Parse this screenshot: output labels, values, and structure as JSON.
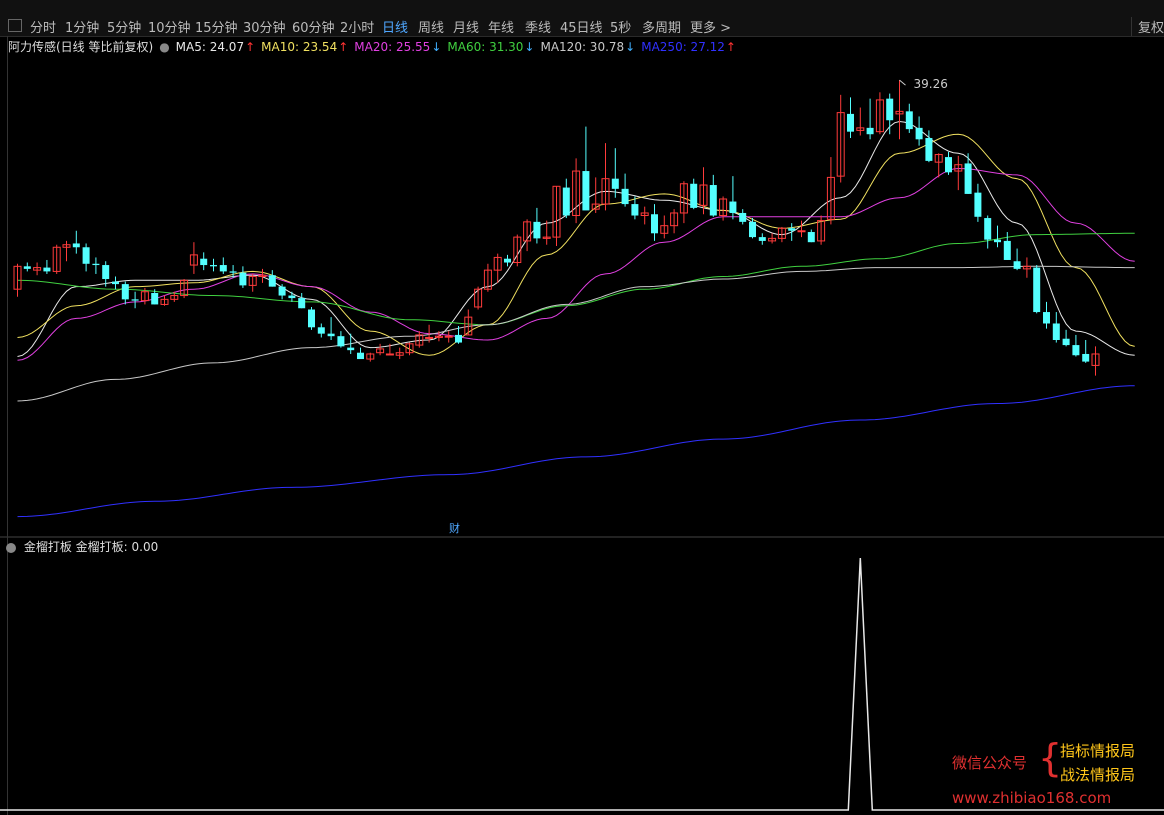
{
  "toolbar": {
    "tabs": [
      "分时",
      "1分钟",
      "5分钟",
      "10分钟",
      "15分钟",
      "30分钟",
      "60分钟",
      "2小时",
      "日线",
      "周线",
      "月线",
      "年线",
      "季线",
      "45日线",
      "5秒",
      "多周期",
      "更多 >"
    ],
    "active": "日线",
    "right_label": "复权"
  },
  "ma_header": {
    "title": "阿力传感(日线 等比前复权)",
    "items": [
      {
        "label": "MA5: 24.07",
        "arrow": "↑",
        "color": "#e8e8e8",
        "arrow_color": "#ff3333"
      },
      {
        "label": "MA10: 23.54",
        "arrow": "↑",
        "color": "#f0e060",
        "arrow_color": "#ff3333"
      },
      {
        "label": "MA20: 25.55",
        "arrow": "↓",
        "color": "#e040e0",
        "arrow_color": "#40b0ff"
      },
      {
        "label": "MA60: 31.30",
        "arrow": "↓",
        "color": "#40d040",
        "arrow_color": "#40b0ff"
      },
      {
        "label": "MA120: 30.78",
        "arrow": "↓",
        "color": "#c8c8c8",
        "arrow_color": "#40b0ff"
      },
      {
        "label": "MA250: 27.12",
        "arrow": "↑",
        "color": "#3030ff",
        "arrow_color": "#ff3333"
      }
    ]
  },
  "main_chart": {
    "peak_label": "39.26",
    "finance_marker": "财"
  },
  "sub_chart": {
    "name": "金榴打板",
    "value_label": "金榴打板: 0.00"
  },
  "watermark": {
    "left": "微信公众号",
    "right1": "指标情报局",
    "right2": "战法情报局",
    "url": "www.zhibiao168.com"
  },
  "chart_data": {
    "type": "candlestick",
    "candles": [
      [
        22.8,
        24.8,
        22.2,
        24.6
      ],
      [
        24.6,
        24.9,
        24.2,
        24.4
      ],
      [
        24.3,
        24.9,
        23.9,
        24.5
      ],
      [
        24.5,
        25.1,
        24.0,
        24.2
      ],
      [
        24.2,
        26.3,
        24.0,
        26.1
      ],
      [
        26.1,
        26.6,
        25.0,
        26.3
      ],
      [
        26.4,
        27.4,
        25.6,
        26.1
      ],
      [
        26.1,
        26.4,
        24.2,
        24.8
      ],
      [
        24.8,
        25.3,
        24.0,
        24.7
      ],
      [
        24.7,
        25.0,
        23.0,
        23.6
      ],
      [
        23.4,
        23.8,
        22.8,
        23.2
      ],
      [
        23.2,
        23.4,
        21.6,
        22.0
      ],
      [
        22.0,
        22.6,
        21.3,
        21.9
      ],
      [
        21.9,
        22.9,
        21.6,
        22.6
      ],
      [
        22.5,
        22.8,
        21.6,
        21.6
      ],
      [
        21.6,
        22.3,
        21.5,
        22.0
      ],
      [
        22.0,
        22.6,
        21.8,
        22.3
      ],
      [
        22.3,
        23.6,
        22.1,
        23.5
      ],
      [
        24.7,
        26.5,
        24.0,
        25.5
      ],
      [
        25.2,
        25.7,
        24.3,
        24.7
      ],
      [
        24.7,
        25.2,
        24.2,
        24.6
      ],
      [
        24.7,
        25.3,
        24.0,
        24.2
      ],
      [
        24.2,
        24.7,
        23.7,
        24.1
      ],
      [
        24.1,
        24.6,
        22.9,
        23.1
      ],
      [
        23.1,
        24.0,
        22.6,
        23.8
      ],
      [
        23.8,
        24.4,
        23.3,
        23.9
      ],
      [
        23.9,
        24.3,
        23.0,
        23.0
      ],
      [
        23.0,
        23.2,
        22.0,
        22.3
      ],
      [
        22.3,
        22.6,
        21.8,
        22.1
      ],
      [
        22.1,
        22.5,
        21.3,
        21.3
      ],
      [
        21.2,
        21.4,
        19.6,
        19.8
      ],
      [
        19.8,
        20.1,
        19.0,
        19.3
      ],
      [
        19.3,
        20.6,
        18.8,
        19.1
      ],
      [
        19.1,
        19.5,
        18.2,
        18.3
      ],
      [
        18.2,
        19.3,
        17.7,
        18.0
      ],
      [
        17.8,
        18.2,
        17.3,
        17.3
      ],
      [
        17.3,
        17.8,
        17.1,
        17.7
      ],
      [
        17.8,
        18.5,
        17.6,
        18.1
      ],
      [
        17.7,
        18.5,
        17.6,
        17.7
      ],
      [
        17.6,
        18.2,
        17.3,
        17.8
      ],
      [
        17.8,
        18.6,
        17.6,
        18.5
      ],
      [
        18.4,
        19.5,
        18.2,
        19.2
      ],
      [
        19.0,
        20.0,
        18.6,
        19.0
      ],
      [
        19.0,
        19.5,
        18.7,
        19.1
      ],
      [
        19.1,
        19.5,
        18.6,
        19.1
      ],
      [
        19.2,
        19.9,
        18.5,
        18.6
      ],
      [
        19.2,
        21.2,
        19.2,
        20.6
      ],
      [
        21.4,
        23.0,
        21.2,
        22.8
      ],
      [
        22.8,
        24.8,
        22.6,
        24.3
      ],
      [
        24.3,
        25.6,
        23.3,
        25.3
      ],
      [
        25.2,
        25.5,
        24.6,
        24.9
      ],
      [
        24.9,
        27.1,
        24.6,
        26.9
      ],
      [
        26.6,
        28.3,
        25.8,
        28.1
      ],
      [
        28.1,
        29.2,
        26.4,
        26.8
      ],
      [
        26.8,
        28.2,
        26.3,
        26.9
      ],
      [
        26.9,
        30.9,
        26.2,
        30.9
      ],
      [
        30.8,
        31.5,
        28.4,
        28.6
      ],
      [
        28.6,
        33.1,
        28.0,
        32.1
      ],
      [
        32.1,
        35.6,
        30.1,
        29.0
      ],
      [
        29.1,
        31.6,
        28.8,
        29.5
      ],
      [
        29.5,
        34.3,
        29.0,
        31.5
      ],
      [
        31.5,
        33.9,
        30.0,
        30.7
      ],
      [
        30.7,
        31.9,
        29.3,
        29.5
      ],
      [
        29.5,
        30.1,
        28.3,
        28.6
      ],
      [
        28.6,
        29.3,
        27.9,
        28.8
      ],
      [
        28.7,
        29.5,
        26.6,
        27.2
      ],
      [
        27.2,
        28.6,
        26.8,
        27.8
      ],
      [
        27.8,
        29.1,
        27.2,
        28.8
      ],
      [
        28.8,
        31.3,
        28.0,
        31.1
      ],
      [
        31.1,
        31.5,
        29.1,
        29.2
      ],
      [
        29.4,
        32.4,
        28.7,
        31.0
      ],
      [
        31.0,
        31.8,
        28.5,
        28.6
      ],
      [
        28.6,
        30.1,
        28.2,
        29.9
      ],
      [
        29.7,
        31.7,
        28.3,
        28.8
      ],
      [
        28.8,
        29.1,
        27.9,
        28.1
      ],
      [
        28.1,
        28.4,
        26.8,
        26.9
      ],
      [
        26.9,
        27.2,
        26.3,
        26.6
      ],
      [
        26.6,
        27.2,
        26.4,
        26.8
      ],
      [
        26.8,
        27.7,
        26.5,
        27.6
      ],
      [
        27.6,
        28.0,
        26.6,
        27.4
      ],
      [
        27.4,
        28.2,
        26.9,
        27.4
      ],
      [
        27.3,
        27.5,
        26.5,
        26.5
      ],
      [
        26.6,
        28.6,
        26.3,
        28.2
      ],
      [
        28.3,
        33.2,
        27.9,
        31.6
      ],
      [
        31.7,
        38.1,
        31.2,
        36.7
      ],
      [
        36.6,
        37.9,
        34.7,
        35.2
      ],
      [
        35.3,
        37.1,
        34.9,
        35.5
      ],
      [
        35.5,
        37.8,
        34.6,
        35.0
      ],
      [
        35.2,
        38.3,
        35.0,
        37.7
      ],
      [
        37.8,
        38.2,
        35.0,
        36.1
      ],
      [
        36.6,
        39.26,
        34.6,
        36.8
      ],
      [
        36.8,
        37.4,
        35.1,
        35.4
      ],
      [
        35.5,
        36.4,
        34.1,
        34.6
      ],
      [
        34.7,
        35.3,
        32.8,
        32.9
      ],
      [
        32.8,
        33.5,
        31.6,
        33.4
      ],
      [
        33.2,
        33.6,
        31.8,
        32.0
      ],
      [
        32.1,
        33.3,
        30.6,
        32.6
      ],
      [
        32.7,
        33.5,
        30.3,
        30.3
      ],
      [
        30.4,
        31.1,
        28.1,
        28.5
      ],
      [
        28.4,
        28.6,
        26.0,
        26.7
      ],
      [
        26.7,
        27.8,
        26.1,
        26.5
      ],
      [
        26.6,
        27.3,
        25.1,
        25.1
      ],
      [
        25.0,
        26.0,
        24.3,
        24.4
      ],
      [
        24.4,
        25.3,
        23.7,
        24.6
      ],
      [
        24.5,
        24.7,
        20.9,
        21.0
      ],
      [
        21.0,
        21.8,
        19.7,
        20.1
      ],
      [
        20.1,
        21.0,
        18.6,
        18.8
      ],
      [
        18.9,
        19.6,
        18.3,
        18.4
      ],
      [
        18.4,
        19.2,
        17.5,
        17.6
      ],
      [
        17.7,
        18.8,
        17.0,
        17.1
      ],
      [
        16.8,
        18.3,
        16.0,
        17.7
      ]
    ],
    "ma_series": [
      {
        "name": "MA5",
        "color": "#e8e8e8",
        "points": [
          [
            0,
            17.5
          ],
          [
            6,
            23.0
          ],
          [
            12,
            23.5
          ],
          [
            18,
            23.5
          ],
          [
            24,
            23.9
          ],
          [
            30,
            22.0
          ],
          [
            36,
            18.2
          ],
          [
            42,
            18.8
          ],
          [
            48,
            23.0
          ],
          [
            54,
            28.0
          ],
          [
            60,
            30.5
          ],
          [
            66,
            29.8
          ],
          [
            72,
            29.0
          ],
          [
            78,
            27.1
          ],
          [
            84,
            30.0
          ],
          [
            90,
            36.0
          ],
          [
            96,
            33.5
          ],
          [
            102,
            28.0
          ],
          [
            108,
            19.5
          ],
          [
            114,
            17.6
          ]
        ]
      },
      {
        "name": "MA10",
        "color": "#f0e060",
        "points": [
          [
            0,
            19.0
          ],
          [
            6,
            21.5
          ],
          [
            12,
            23.0
          ],
          [
            18,
            23.3
          ],
          [
            24,
            24.2
          ],
          [
            30,
            23.0
          ],
          [
            36,
            19.5
          ],
          [
            42,
            17.6
          ],
          [
            48,
            20.0
          ],
          [
            54,
            25.5
          ],
          [
            60,
            29.5
          ],
          [
            66,
            30.3
          ],
          [
            72,
            29.0
          ],
          [
            78,
            27.6
          ],
          [
            84,
            28.3
          ],
          [
            90,
            33.5
          ],
          [
            96,
            35.0
          ],
          [
            102,
            31.5
          ],
          [
            108,
            24.5
          ],
          [
            114,
            18.3
          ]
        ]
      },
      {
        "name": "MA20",
        "color": "#e040e0",
        "points": [
          [
            0,
            17.2
          ],
          [
            6,
            20.5
          ],
          [
            12,
            21.8
          ],
          [
            18,
            22.8
          ],
          [
            24,
            24.0
          ],
          [
            30,
            23.0
          ],
          [
            36,
            21.0
          ],
          [
            42,
            19.3
          ],
          [
            48,
            18.8
          ],
          [
            54,
            20.5
          ],
          [
            60,
            24.0
          ],
          [
            66,
            26.5
          ],
          [
            72,
            28.5
          ],
          [
            78,
            28.5
          ],
          [
            84,
            28.5
          ],
          [
            90,
            30.0
          ],
          [
            96,
            32.3
          ],
          [
            102,
            31.8
          ],
          [
            108,
            28.0
          ],
          [
            114,
            25.0
          ]
        ]
      },
      {
        "name": "MA60",
        "color": "#40d040",
        "points": [
          [
            0,
            23.5
          ],
          [
            10,
            22.8
          ],
          [
            20,
            22.3
          ],
          [
            30,
            21.8
          ],
          [
            40,
            20.4
          ],
          [
            48,
            20.0
          ],
          [
            56,
            21.5
          ],
          [
            64,
            22.8
          ],
          [
            72,
            23.8
          ],
          [
            80,
            24.6
          ],
          [
            88,
            25.2
          ],
          [
            96,
            26.4
          ],
          [
            104,
            27.1
          ],
          [
            114,
            27.2
          ]
        ]
      },
      {
        "name": "MA120",
        "color": "#c8c8c8",
        "points": [
          [
            0,
            14.0
          ],
          [
            10,
            15.7
          ],
          [
            20,
            17.0
          ],
          [
            30,
            18.2
          ],
          [
            40,
            19.1
          ],
          [
            48,
            20.0
          ],
          [
            56,
            21.6
          ],
          [
            64,
            23.0
          ],
          [
            72,
            23.6
          ],
          [
            80,
            24.2
          ],
          [
            88,
            24.5
          ],
          [
            96,
            24.5
          ],
          [
            104,
            24.6
          ],
          [
            114,
            24.5
          ]
        ]
      },
      {
        "name": "MA250",
        "color": "#3030ff",
        "points": [
          [
            0,
            4.9
          ],
          [
            14,
            6.1
          ],
          [
            28,
            7.2
          ],
          [
            44,
            8.2
          ],
          [
            58,
            9.6
          ],
          [
            72,
            11.0
          ],
          [
            86,
            12.5
          ],
          [
            100,
            13.8
          ],
          [
            114,
            15.2
          ]
        ]
      }
    ],
    "ylim": [
      4,
      41
    ],
    "indicator": {
      "name": "金榴打板",
      "values_nonzero": [
        [
          86,
          1
        ]
      ],
      "ylim": [
        0,
        1
      ]
    }
  }
}
